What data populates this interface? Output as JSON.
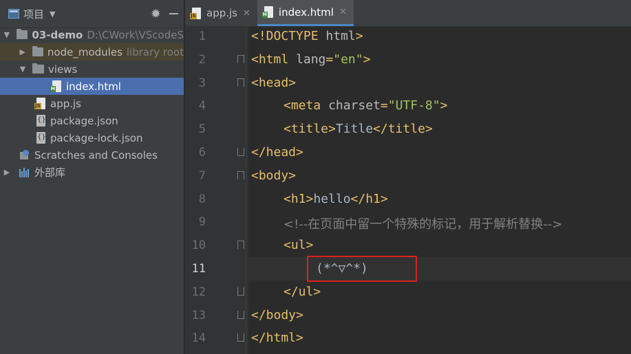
{
  "sidebar": {
    "title": "项目",
    "items": [
      {
        "label": "03-demo",
        "path": "D:\\CWork\\VScodeS"
      },
      {
        "label": "node_modules",
        "note": "library root"
      },
      {
        "label": "views"
      },
      {
        "label": "index.html"
      },
      {
        "label": "app.js"
      },
      {
        "label": "package.json"
      },
      {
        "label": "package-lock.json"
      },
      {
        "label": "Scratches and Consoles"
      },
      {
        "label": "外部库"
      }
    ]
  },
  "tabs": [
    {
      "label": "app.js",
      "icon": "js-file-icon"
    },
    {
      "label": "index.html",
      "icon": "html-file-icon",
      "active": true
    }
  ],
  "editor": {
    "current_line": 11,
    "lines": [
      {
        "n": "1",
        "segments": [
          [
            "t",
            "<!DOCTYPE "
          ],
          [
            "a",
            "html"
          ],
          [
            "t",
            ">"
          ]
        ]
      },
      {
        "n": "2",
        "segments": [
          [
            "t",
            "<html "
          ],
          [
            "a",
            "lang"
          ],
          [
            "t",
            "="
          ],
          [
            "v",
            "\"en\""
          ],
          [
            "t",
            ">"
          ]
        ]
      },
      {
        "n": "3",
        "segments": [
          [
            "t",
            "<head>"
          ]
        ]
      },
      {
        "n": "4",
        "segments": [
          [
            "t",
            "<meta "
          ],
          [
            "a",
            "charset"
          ],
          [
            "t",
            "="
          ],
          [
            "v",
            "\"UTF-8\""
          ],
          [
            "t",
            ">"
          ]
        ]
      },
      {
        "n": "5",
        "segments": [
          [
            "t",
            "<title>"
          ],
          [
            "p",
            "Title"
          ],
          [
            "t",
            "</title>"
          ]
        ]
      },
      {
        "n": "6",
        "segments": [
          [
            "t",
            "</head>"
          ]
        ]
      },
      {
        "n": "7",
        "segments": [
          [
            "t",
            "<body>"
          ]
        ]
      },
      {
        "n": "8",
        "segments": [
          [
            "t",
            "<h1>"
          ],
          [
            "p",
            "hello"
          ],
          [
            "t",
            "</h1>"
          ]
        ]
      },
      {
        "n": "9",
        "segments": [
          [
            "c",
            "<!--在页面中留一个特殊的标记，用于解析替换-->"
          ]
        ]
      },
      {
        "n": "10",
        "segments": [
          [
            "t",
            "<ul>"
          ]
        ]
      },
      {
        "n": "11",
        "segments": [
          [
            "p",
            "(*^▽^*)"
          ]
        ]
      },
      {
        "n": "12",
        "segments": [
          [
            "t",
            "</ul>"
          ]
        ]
      },
      {
        "n": "13",
        "segments": [
          [
            "t",
            "</body>"
          ]
        ]
      },
      {
        "n": "14",
        "segments": [
          [
            "t",
            "</html>"
          ]
        ]
      }
    ]
  },
  "colors": {
    "tag": "#e8bf6a",
    "attr": "#bababa",
    "value": "#a5c25c",
    "text": "#a9b7c6",
    "comment": "#808080",
    "highlight_box": "#e01f1f",
    "selection": "#4b6eaf"
  }
}
